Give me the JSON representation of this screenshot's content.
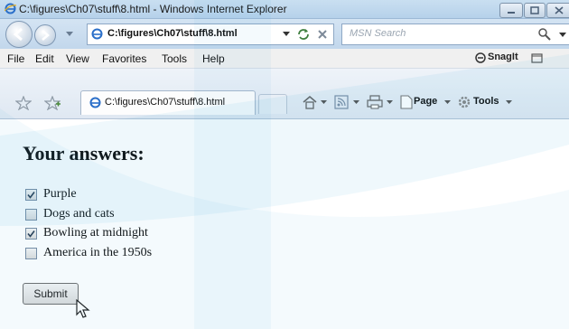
{
  "window": {
    "title": "C:\\figures\\Ch07\\stuff\\8.html - Windows Internet Explorer"
  },
  "address_bar": {
    "url": "C:\\figures\\Ch07\\stuff\\8.html"
  },
  "search": {
    "placeholder": "MSN Search"
  },
  "menu": {
    "items": [
      "File",
      "Edit",
      "View",
      "Favorites",
      "Tools",
      "Help"
    ],
    "snagit": "SnagIt"
  },
  "tab": {
    "title": "C:\\figures\\Ch07\\stuff\\8.html"
  },
  "toolbar": {
    "page_label": "Page",
    "tools_label": "Tools"
  },
  "page": {
    "heading": "Your answers:",
    "answers": [
      {
        "label": "Purple",
        "checked": true
      },
      {
        "label": "Dogs and cats",
        "checked": false
      },
      {
        "label": "Bowling at midnight",
        "checked": true
      },
      {
        "label": "America in the 1950s",
        "checked": false
      }
    ],
    "submit_label": "Submit"
  },
  "colors": {
    "chrome": "#c9dff1",
    "watermark": "#1e9fd6"
  }
}
